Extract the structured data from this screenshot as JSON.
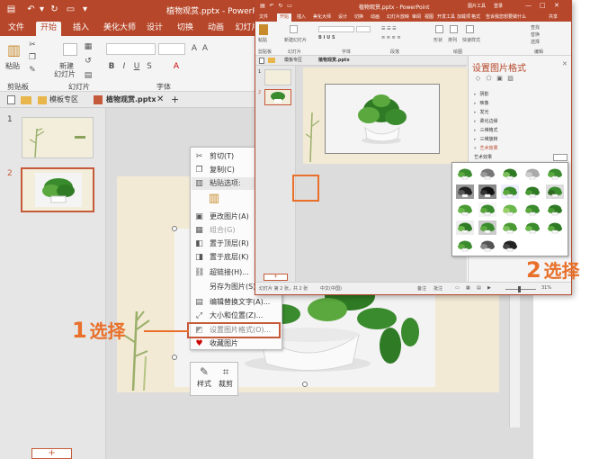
{
  "main": {
    "file_title": "植物观赏.pptx - PowerP",
    "tabs": [
      "文件",
      "开始",
      "插入",
      "美化大师",
      "设计",
      "切换",
      "动画",
      "幻灯片"
    ],
    "ribbon": {
      "paste": "粘贴",
      "new_slide_1": "新建",
      "new_slide_2": "幻灯片",
      "group_clipboard": "剪贴板",
      "group_slides": "幻灯片",
      "group_font": "字体"
    },
    "doc_tabs": [
      "模板专区",
      "植物观赏.pptx"
    ],
    "slide_numbers": [
      "1",
      "2"
    ],
    "new_slide_btn": "+"
  },
  "context_menu": {
    "items": [
      "剪切(T)",
      "复制(C)",
      "粘贴选项:",
      "",
      "更改图片(A)",
      "组合(G)",
      "置于顶层(R)",
      "置于底层(K)",
      "超链接(H)...",
      "另存为图片(S)...",
      "编辑替换文字(A)...",
      "大小和位置(Z)...",
      "设置图片格式(O)...",
      "收藏图片"
    ],
    "mini_toolbar": [
      "样式",
      "裁剪"
    ]
  },
  "callouts": {
    "step1_num": "1",
    "step1_text": "选择",
    "step2_num": "2",
    "step2_text": "选择"
  },
  "overlay": {
    "file_title": "植物观赏.pptx - PowerPoint",
    "tools_label": "图片工具",
    "account": "登录",
    "tabs": [
      "文件",
      "开始",
      "插入",
      "美化大师",
      "设计",
      "切换",
      "动画",
      "幻灯片放映",
      "审阅",
      "视图",
      "开发工具",
      "加载项",
      "格式"
    ],
    "tellme": "告诉我您想要做什么",
    "share": "共享",
    "ribbon": {
      "paste": "粘贴",
      "new_slide": "新建幻灯片",
      "group_clipboard": "剪贴板",
      "group_slides": "幻灯片",
      "group_font": "字体",
      "group_paragraph": "段落",
      "shapes": "形状",
      "arrange": "排列",
      "quick_styles": "快速样式",
      "group_drawing": "绘图",
      "find": "查找",
      "replace": "替换",
      "select": "选择",
      "group_editing": "编辑"
    },
    "doc_tabs": [
      "模板专区",
      "植物观赏.pptx"
    ],
    "slide_numbers": [
      "1",
      "2"
    ],
    "new_slide_btn": "+",
    "panel": {
      "title": "设置图片格式",
      "sections": [
        "阴影",
        "映像",
        "发光",
        "柔化边缘",
        "三维格式",
        "三维旋转",
        "艺术效果"
      ],
      "art_label": "艺术效果"
    },
    "status": {
      "slide": "幻灯片 第 2 张，共 2 张",
      "lang": "中文(中国)",
      "notes": "备注",
      "comments": "批注",
      "zoom": "31%"
    }
  }
}
